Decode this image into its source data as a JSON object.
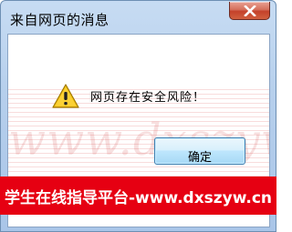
{
  "dialog": {
    "title": "来自网页的消息",
    "message": "网页存在安全风险！",
    "ok_label": "确定",
    "close_icon": "close-icon",
    "warning_icon": "warning-icon"
  },
  "watermark": {
    "text": "www.dxszyw.cn"
  },
  "banner": {
    "text": "学生在线指导平台-www.dxszyw.cn",
    "color": "#e60012"
  }
}
